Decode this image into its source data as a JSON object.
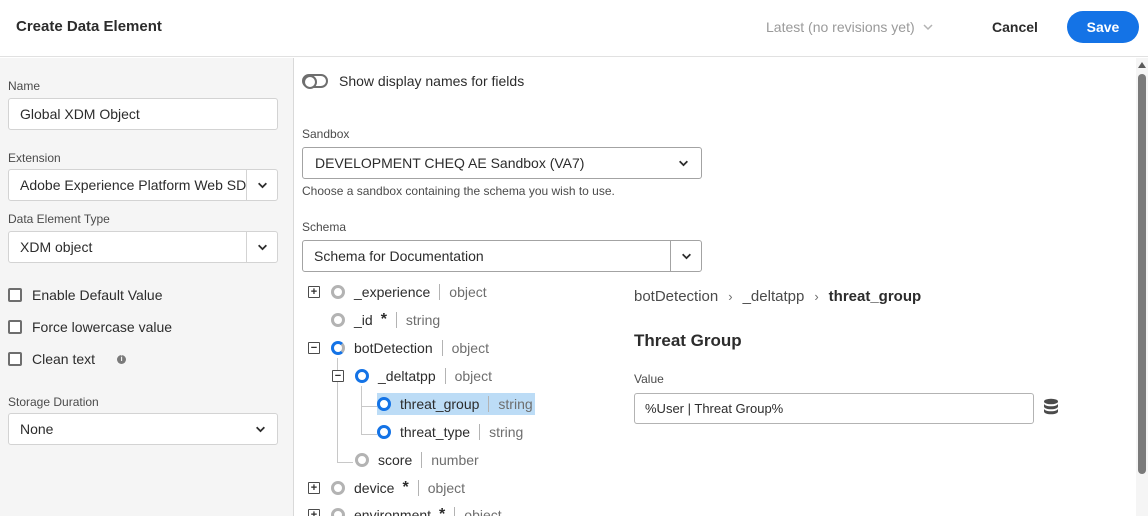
{
  "header": {
    "title": "Create Data Element",
    "revisions": "Latest (no revisions yet)",
    "cancel_label": "Cancel",
    "save_label": "Save"
  },
  "left": {
    "name_label": "Name",
    "name_value": "Global XDM Object",
    "extension_label": "Extension",
    "extension_value": "Adobe Experience Platform Web SDK",
    "type_label": "Data Element Type",
    "type_value": "XDM object",
    "checkboxes": [
      {
        "label": "Enable Default Value",
        "checked": false
      },
      {
        "label": "Force lowercase value",
        "checked": false
      },
      {
        "label": "Clean text",
        "checked": false
      }
    ],
    "info_icon": "i",
    "storage_label": "Storage Duration",
    "storage_value": "None"
  },
  "right": {
    "toggle_label": "Show display names for fields",
    "sandbox_label": "Sandbox",
    "sandbox_value": "DEVELOPMENT CHEQ AE Sandbox (VA7)",
    "sandbox_help": "Choose a sandbox containing the schema you wish to use.",
    "schema_label": "Schema",
    "schema_value": "Schema for Documentation",
    "tree": [
      {
        "name": "_experience",
        "type": "object",
        "required": false,
        "expander": "+",
        "node": "empty"
      },
      {
        "name": "_id",
        "type": "string",
        "required": true,
        "node": "empty"
      },
      {
        "name": "botDetection",
        "type": "object",
        "required": false,
        "expander": "−",
        "node": "partial"
      },
      {
        "name": "_deltatpp",
        "type": "object",
        "required": false,
        "expander": "−",
        "node": "full"
      },
      {
        "name": "threat_group",
        "type": "string",
        "required": false,
        "node": "full",
        "selected": true
      },
      {
        "name": "threat_type",
        "type": "string",
        "required": false,
        "node": "full"
      },
      {
        "name": "score",
        "type": "number",
        "required": false,
        "node": "empty"
      },
      {
        "name": "device",
        "type": "object",
        "required": true,
        "expander": "+",
        "node": "empty"
      },
      {
        "name": "environment",
        "type": "object",
        "required": true,
        "expander": "+",
        "node": "empty"
      }
    ],
    "required_mark": "*",
    "breadcrumb": [
      "botDetection",
      "_deltatpp",
      "threat_group"
    ],
    "breadcrumb_sep": "›",
    "detail_title": "Threat Group",
    "value_label": "Value",
    "value_text": "%User | Threat Group%"
  },
  "colors": {
    "accent": "#1473e6",
    "selection": "#bcdcf6"
  },
  "icons": [
    "chevron-down-icon",
    "info-icon",
    "database-icon",
    "expand-icon",
    "collapse-icon"
  ]
}
